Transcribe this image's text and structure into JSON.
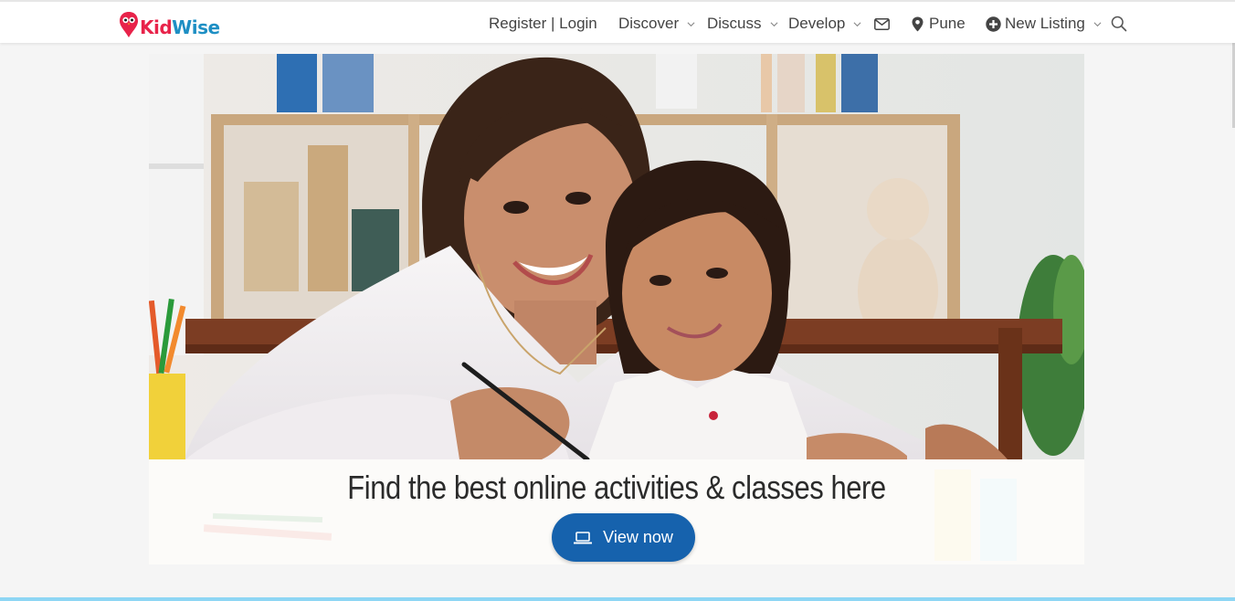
{
  "brand": {
    "name_part1": "Kid",
    "name_part2": "Wise",
    "red": "#e8234a",
    "blue": "#1e8fc4"
  },
  "nav": {
    "register_login": "Register | Login",
    "discover": "Discover",
    "discuss": "Discuss",
    "develop": "Develop",
    "location": "Pune",
    "new_listing": "New Listing"
  },
  "icons": {
    "mail": "envelope-icon",
    "location": "map-marker-icon",
    "new_listing": "plus-circle-icon",
    "search": "search-icon",
    "dropdown": "chevron-down-icon",
    "button": "laptop-icon"
  },
  "hero": {
    "title": "Find the best online activities & classes here",
    "button_label": "View now",
    "button_color": "#1662ad"
  },
  "colors": {
    "page_bg": "#f5f5f5",
    "accent_line": "#8ed6f4"
  }
}
